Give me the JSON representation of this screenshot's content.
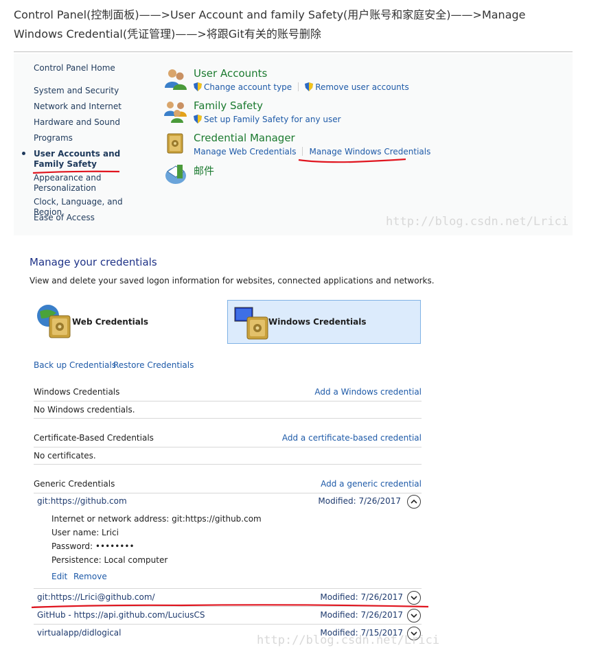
{
  "heading": "Control Panel(控制面板)——>User Account and family Safety(用户账号和家庭安全)——>Manage Windows Credential(凭证管理)——>将跟Git有关的账号删除",
  "sidebar": {
    "items": [
      "Control Panel Home",
      "System and Security",
      "Network and Internet",
      "Hardware and Sound",
      "Programs",
      "User Accounts and Family Safety",
      "Appearance and Personalization",
      "Clock, Language, and Region",
      "Ease of Access"
    ],
    "active_index": 5
  },
  "categories": {
    "user_accounts": {
      "title": "User Accounts",
      "links": [
        "Change account type",
        "Remove user accounts"
      ],
      "icon": "users-icon"
    },
    "family_safety": {
      "title": "Family Safety",
      "links": [
        "Set up Family Safety for any user"
      ],
      "icon": "family-icon"
    },
    "credential_manager": {
      "title": "Credential Manager",
      "links": [
        "Manage Web Credentials",
        "Manage Windows Credentials"
      ],
      "icon": "vault-icon"
    },
    "mail": {
      "title": "邮件",
      "icon": "mail-icon"
    }
  },
  "watermark": "http://blog.csdn.net/Lrici",
  "manage": {
    "title": "Manage your credentials",
    "description": "View and delete your saved logon information for websites, connected applications and networks.",
    "tabs": {
      "web": "Web Credentials",
      "windows": "Windows Credentials"
    },
    "backup": "Back up Credentials",
    "restore": "Restore Credentials"
  },
  "sections": {
    "windows": {
      "title": "Windows Credentials",
      "add": "Add a Windows credential",
      "empty": "No Windows credentials."
    },
    "certificate": {
      "title": "Certificate-Based Credentials",
      "add": "Add a certificate-based credential",
      "empty": "No certificates."
    },
    "generic": {
      "title": "Generic Credentials",
      "add": "Add a generic credential"
    }
  },
  "generic_credentials": [
    {
      "name": "git:https://github.com",
      "modified": "Modified:  7/26/2017",
      "expanded": true
    },
    {
      "name": "git:https://Lrici@github.com/",
      "modified": "Modified:  7/26/2017",
      "expanded": false
    },
    {
      "name": "GitHub - https://api.github.com/LuciusCS",
      "modified": "Modified:  7/26/2017",
      "expanded": false
    },
    {
      "name": "virtualapp/didlogical",
      "modified": "Modified:  7/15/2017",
      "expanded": false
    }
  ],
  "detail": {
    "address": "Internet or network address:  git:https://github.com",
    "user": "User name:  Lrici",
    "password": "Password:  ••••••••",
    "persistence": "Persistence:  Local computer",
    "edit": "Edit",
    "remove": "Remove"
  },
  "colors": {
    "link": "#1e5aa8",
    "category_title": "#1b7a2f",
    "selected_tab": "#dcebfc",
    "annotation": "#e0141e"
  }
}
